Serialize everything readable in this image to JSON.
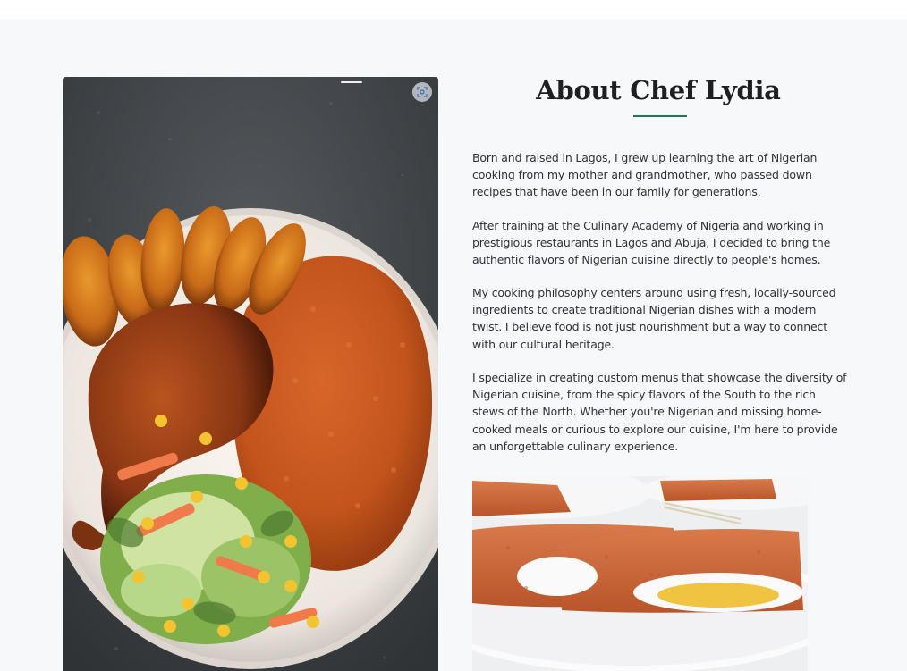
{
  "about": {
    "title": "About Chef Lydia",
    "paragraphs": [
      "Born and raised in Lagos, I grew up learning the art of Nigerian cooking from my mother and grandmother, who passed down recipes that have been in our family for generations.",
      "After training at the Culinary Academy of Nigeria and working in prestigious restaurants in Lagos and Abuja, I decided to bring the authentic flavors of Nigerian cuisine directly to people's homes.",
      "My cooking philosophy centers around using fresh, locally-sourced ingredients to create traditional Nigerian dishes with a modern twist. I believe food is not just nourishment but a way to connect with our cultural heritage.",
      "I specialize in creating custom menus that showcase the diversity of Nigerian cuisine, from the spicy flavors of the South to the rich stews of the North. Whether you're Nigerian and missing home-cooked meals or curious to explore our cuisine, I'm here to provide an unforgettable culinary experience."
    ]
  },
  "images": {
    "main_photo_icon": "image-search-lens-icon",
    "main_photo_subject": "jollof-rice-plantain-chicken-salad",
    "secondary_photo_subject": "moi-moi-with-egg"
  },
  "colors": {
    "accent": "#1a7a55",
    "background": "#f7f8fa",
    "heading": "#1d1f22",
    "body_text": "#2e3238"
  }
}
